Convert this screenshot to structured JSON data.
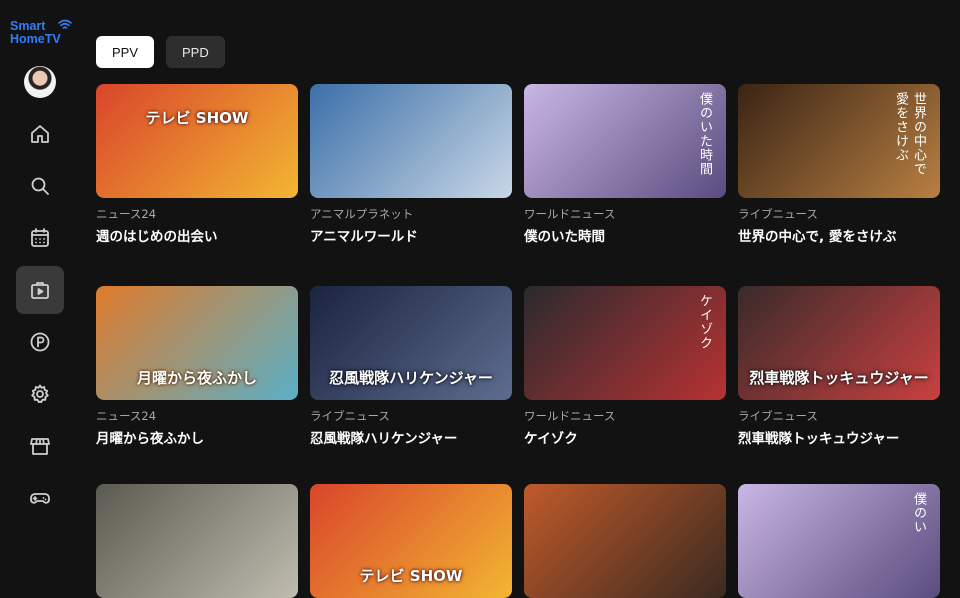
{
  "app": {
    "logo_line1": "Smart",
    "logo_line2": "HomeTV"
  },
  "nav": [
    {
      "name": "home",
      "icon": "home-icon"
    },
    {
      "name": "search",
      "icon": "search-icon"
    },
    {
      "name": "schedule",
      "icon": "calendar-icon"
    },
    {
      "name": "ppv",
      "icon": "play-bag-icon",
      "active": true
    },
    {
      "name": "points",
      "icon": "p-circle-icon"
    },
    {
      "name": "settings",
      "icon": "gear-icon"
    },
    {
      "name": "store",
      "icon": "store-icon"
    },
    {
      "name": "games",
      "icon": "gamepad-icon"
    }
  ],
  "tabs": [
    {
      "label": "PPV",
      "active": true
    },
    {
      "label": "PPD",
      "active": false
    }
  ],
  "cards": [
    {
      "channel": "ニュース24",
      "title": "週のはじめの出会い",
      "overlay": "テレビ SHOW",
      "colors": [
        "#d9452b",
        "#f2b632"
      ]
    },
    {
      "channel": "アニマルプラネット",
      "title": "アニマルワールド",
      "overlay": "",
      "colors": [
        "#3b6fa8",
        "#c9d7e6"
      ]
    },
    {
      "channel": "ワールドニュース",
      "title": "僕のいた時間",
      "vertical": "僕のいた時間",
      "colors": [
        "#c8b6e6",
        "#5a4c7d"
      ]
    },
    {
      "channel": "ライブニュース",
      "title": "世界の中心で, 愛をさけぶ",
      "vertical": "世界の中心で",
      "vertical2": "愛をさけぶ",
      "colors": [
        "#3a2414",
        "#b88042"
      ]
    },
    {
      "channel": "ニュース24",
      "title": "月曜から夜ふかし",
      "overlay": "月曜から夜ふかし",
      "colors": [
        "#e07a2b",
        "#5ab0c7"
      ]
    },
    {
      "channel": "ライブニュース",
      "title": "忍風戦隊ハリケンジャー",
      "overlay": "忍風戦隊ハリケンジャー",
      "colors": [
        "#1b2340",
        "#5e6d8f"
      ]
    },
    {
      "channel": "ワールドニュース",
      "title": "ケイゾク",
      "vertical": "ケイゾク",
      "colors": [
        "#2a2a2e",
        "#b83232"
      ]
    },
    {
      "channel": "ライブニュース",
      "title": "烈車戦隊トッキュウジャー",
      "overlay": "烈車戦隊トッキュウジャー",
      "colors": [
        "#3a2a2a",
        "#c94040"
      ]
    },
    {
      "channel": "",
      "title": "",
      "colors": [
        "#5a5a50",
        "#c0bdb0"
      ]
    },
    {
      "channel": "",
      "title": "",
      "overlay": "テレビ SHOW",
      "colors": [
        "#d9452b",
        "#f2b632"
      ]
    },
    {
      "channel": "",
      "title": "",
      "colors": [
        "#c05a2a",
        "#3a2a20"
      ]
    },
    {
      "channel": "",
      "title": "",
      "vertical": "僕のい",
      "colors": [
        "#c8b6e6",
        "#5a4c7d"
      ]
    }
  ]
}
